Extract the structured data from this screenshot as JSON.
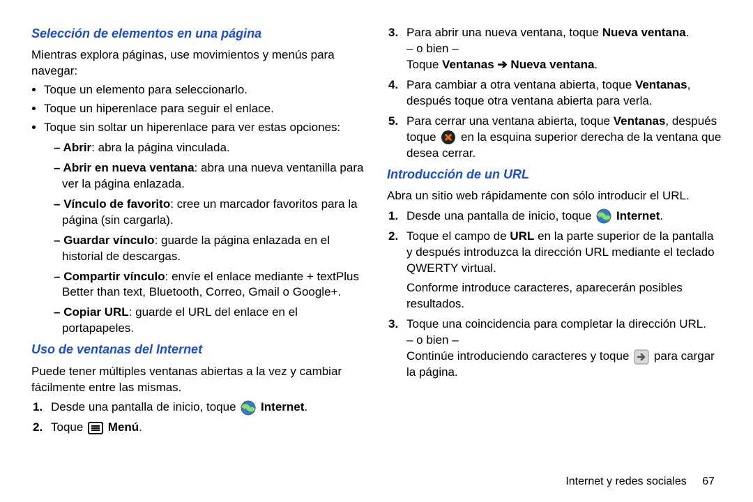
{
  "left": {
    "h1": "Selección de elementos en una página",
    "p1": "Mientras explora páginas, use movimientos y menús para navegar:",
    "b1": "Toque un elemento para seleccionarlo.",
    "b2": "Toque un hiperenlace para seguir el enlace.",
    "b3": "Toque sin soltar un hiperenlace para ver estas opciones:",
    "d1a": "Abrir",
    "d1b": ": abra la página vinculada.",
    "d2a": "Abrir en nueva ventana",
    "d2b": ": abra una nueva ventanilla para ver la página enlazada.",
    "d3a": "Vínculo de favorito",
    "d3b": ": cree un marcador favoritos para la página (sin cargarla).",
    "d4a": "Guardar vínculo",
    "d4b": ": guarde la página enlazada en el historial de descargas.",
    "d5a": "Compartir vínculo",
    "d5b": ": envíe el enlace mediante + textPlus Better than text, Bluetooth, Correo, Gmail o Google+.",
    "d6a": "Copiar URL",
    "d6b": ": guarde el URL del enlace en el portapapeles.",
    "h2": "Uso de ventanas del Internet",
    "p2": "Puede tener múltiples ventanas abiertas a la vez y cambiar fácilmente entre las mismas.",
    "s1a": "Desde una pantalla de inicio, toque ",
    "s1b": "Internet",
    "s2a": "Toque ",
    "s2b": "Menú"
  },
  "right": {
    "s3a": "Para abrir una nueva ventana, toque ",
    "s3b": "Nueva ventana",
    "s3c": "– o bien –",
    "s3d": "Toque ",
    "s3e": "Ventanas",
    "s3f": "Nueva ventana",
    "s4a": "Para cambiar a otra ventana abierta, toque ",
    "s4b": "Ventanas",
    "s4c": ", después toque otra ventana abierta para verla.",
    "s5a": "Para cerrar una ventana abierta, toque ",
    "s5b": "Ventanas",
    "s5c": ", después toque ",
    "s5d": " en la esquina superior derecha de la ventana que desea cerrar.",
    "h3": "Introducción de un URL",
    "p3": "Abra un sitio web rápidamente con sólo introducir el URL.",
    "u1a": "Desde una pantalla de inicio, toque ",
    "u1b": "Internet",
    "u2a": "Toque el campo de ",
    "u2b": "URL",
    "u2c": " en la parte superior de la pantalla y después introduzca la dirección URL mediante el teclado QWERTY virtual.",
    "u2d": "Conforme introduce caracteres, aparecerán posibles resultados.",
    "u3a": "Toque una coincidencia para completar la dirección URL.",
    "u3b": "– o bien –",
    "u3c": "Continúe introduciendo caracteres y toque ",
    "u3d": " para cargar la página."
  },
  "footer": {
    "section": "Internet y redes sociales",
    "page": "67"
  }
}
